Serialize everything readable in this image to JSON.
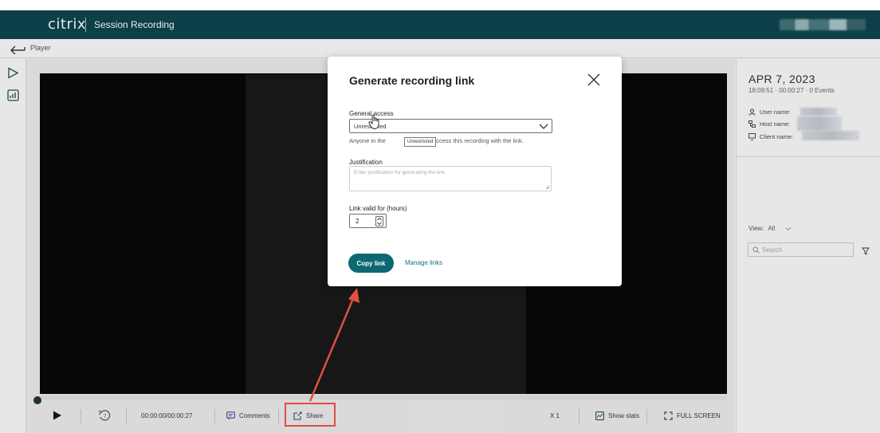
{
  "app": {
    "logo": "citrix",
    "product": "Session Recording"
  },
  "subbar": {
    "title": "Player"
  },
  "rail": {
    "items": [
      "play-icon",
      "stats-icon"
    ]
  },
  "player": {
    "time": "00:00:00/00:00:27",
    "comments_label": "Comments",
    "share_label": "Share",
    "speed": "X 1",
    "show_stats_label": "Show stats",
    "fullscreen_label": "FULL SCREEN",
    "progress": 0
  },
  "details": {
    "date": "APR 7, 2023",
    "time_events": "18:09:51 · 00:00:27 · 0 Events",
    "user_label": "User name:",
    "host_label": "Host name:",
    "client_label": "Client name:",
    "view_label": "View:",
    "view_value": "All",
    "search_placeholder": "Search"
  },
  "modal": {
    "title": "Generate recording link",
    "general_access_label": "General access",
    "general_access_value": "Unrestricted",
    "help_start": "Anyone in the",
    "help_end": "access this recording with the link.",
    "tooltip": "Unrestricted",
    "justification_label": "Justification",
    "justification_placeholder": "Enter justification for generating the link",
    "link_valid_label": "Link valid for (hours)",
    "link_valid_value": "2",
    "copy_button": "Copy link",
    "manage_link": "Manage links"
  },
  "colors": {
    "topbar": "#0c3f47",
    "accent": "#0e6873",
    "annotation": "#e04f43"
  }
}
